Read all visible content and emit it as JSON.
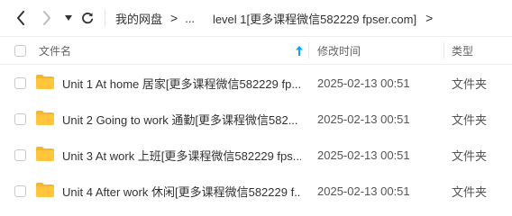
{
  "breadcrumb": {
    "root": "我的网盘",
    "ellipsis": "...",
    "current": "level 1[更多课程微信582229 fpser.com]"
  },
  "columns": {
    "name": "文件名",
    "modified": "修改时间",
    "type": "类型"
  },
  "files": [
    {
      "name": "Unit 1 At home 居家[更多课程微信582229 fp...",
      "modified": "2025-02-13 00:51",
      "type": "文件夹"
    },
    {
      "name": "Unit 2 Going to work 通勤[更多课程微信582...",
      "modified": "2025-02-13 00:51",
      "type": "文件夹"
    },
    {
      "name": "Unit 3 At work 上班[更多课程微信582229 fps...",
      "modified": "2025-02-13 00:51",
      "type": "文件夹"
    },
    {
      "name": "Unit 4 After work 休闲[更多课程微信582229 f...",
      "modified": "2025-02-13 00:51",
      "type": "文件夹"
    }
  ],
  "colors": {
    "accent": "#06a7ff",
    "folder": "#ffc53d",
    "folder_back": "#f7b52c",
    "divider": "#eeeeee"
  }
}
